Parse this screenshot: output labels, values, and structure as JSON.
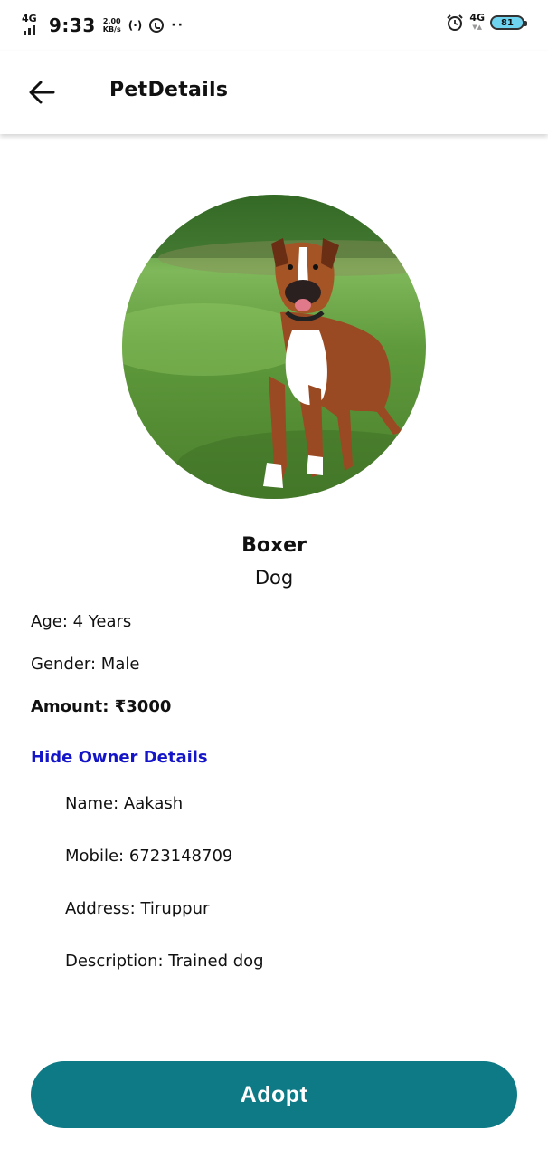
{
  "status_bar": {
    "network_type": "4G",
    "time": "9:33",
    "speed_value": "2.00",
    "speed_unit": "KB/s",
    "right_network": "4G",
    "battery": "81"
  },
  "app_bar": {
    "title": "PetDetails",
    "back_icon": "arrow-left-icon"
  },
  "pet": {
    "photo_icon": "boxer-dog-photo",
    "breed": "Boxer",
    "type": "Dog",
    "age": "Age: 4 Years",
    "gender": "Gender: Male",
    "amount": "Amount: ₹3000"
  },
  "owner": {
    "toggle_label": "Hide Owner Details",
    "name": "Name: Aakash",
    "mobile": "Mobile: 6723148709",
    "address": "Address: Tiruppur",
    "description": "Description: Trained dog"
  },
  "actions": {
    "adopt_label": "Adopt"
  },
  "colors": {
    "accent": "#0e7a86",
    "link": "#1414c8"
  }
}
